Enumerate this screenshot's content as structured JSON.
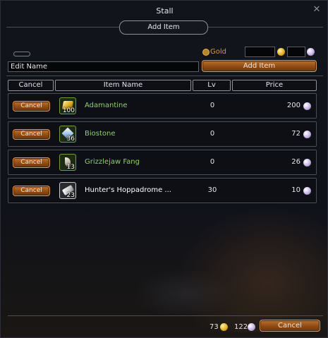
{
  "window": {
    "title": "Stall"
  },
  "add_item_tab": "Add Item",
  "currency": {
    "gold_label": "Gold",
    "gold_value": "",
    "pearl_value": ""
  },
  "name_field": {
    "value": "Edit Name"
  },
  "add_item_button": "Add Item",
  "table": {
    "headers": {
      "cancel": "Cancel",
      "item_name": "Item Name",
      "lv": "Lv",
      "price": "Price"
    },
    "rows": [
      {
        "cancel": "Cancel",
        "name": "Adamantine",
        "qty": "100",
        "lv": "0",
        "price": "200",
        "name_color": "#8fd06a",
        "icon": "gold-ore-icon"
      },
      {
        "cancel": "Cancel",
        "name": "Biostone",
        "qty": "36",
        "lv": "0",
        "price": "72",
        "name_color": "#8fd06a",
        "icon": "crystal-icon"
      },
      {
        "cancel": "Cancel",
        "name": "Grizzlejaw Fang",
        "qty": "13",
        "lv": "0",
        "price": "26",
        "name_color": "#8fd06a",
        "icon": "fang-icon"
      },
      {
        "cancel": "Cancel",
        "name": "Hunter's Hoppadrome ...",
        "qty": "23",
        "lv": "30",
        "price": "10",
        "name_color": "#ffffff",
        "icon": "scroll-icon"
      }
    ]
  },
  "footer": {
    "gold": "73",
    "pearls": "122",
    "cancel": "Cancel"
  },
  "colors": {
    "accent_orange": "#b0621f",
    "item_green": "#8fd06a",
    "gold_label": "#d49a3a"
  }
}
